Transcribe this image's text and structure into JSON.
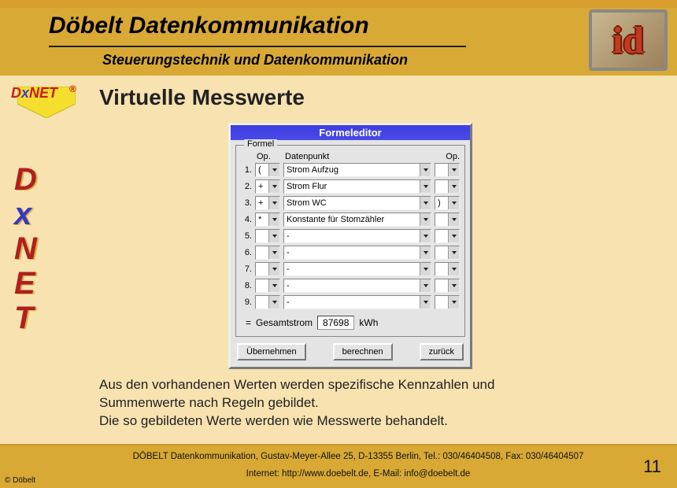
{
  "header": {
    "title": "Döbelt Datenkommunikation",
    "subtitle": "Steuerungstechnik und Datenkommunikation",
    "logo_text": "id"
  },
  "brand": {
    "d": "D",
    "x": "x",
    "net": "NET",
    "reg": "®"
  },
  "vertical": [
    "D",
    "x",
    "N",
    "E",
    "T"
  ],
  "slide_title": "Virtuelle Messwerte",
  "editor": {
    "title": "Formeleditor",
    "legend": "Formel",
    "col_op": "Op.",
    "col_dp": "Datenpunkt",
    "col_op2": "Op.",
    "rows": [
      {
        "n": "1.",
        "op1": "(",
        "dp": "Strom Aufzug",
        "op2": ""
      },
      {
        "n": "2.",
        "op1": "+",
        "dp": "Strom Flur",
        "op2": ""
      },
      {
        "n": "3.",
        "op1": "+",
        "dp": "Strom WC",
        "op2": ")"
      },
      {
        "n": "4.",
        "op1": "*",
        "dp": "Konstante für Stomzähler",
        "op2": ""
      },
      {
        "n": "5.",
        "op1": "",
        "dp": "-",
        "op2": ""
      },
      {
        "n": "6.",
        "op1": "",
        "dp": "-",
        "op2": ""
      },
      {
        "n": "7.",
        "op1": "",
        "dp": "-",
        "op2": ""
      },
      {
        "n": "8.",
        "op1": "",
        "dp": "-",
        "op2": ""
      },
      {
        "n": "9.",
        "op1": "",
        "dp": "-",
        "op2": ""
      }
    ],
    "result_prefix": "=",
    "result_label": "Gesamtstrom",
    "result_value": "87698",
    "result_unit": "kWh",
    "btn_apply": "Übernehmen",
    "btn_calc": "berechnen",
    "btn_back": "zurück"
  },
  "caption_line1": "Aus den vorhandenen Werten werden spezifische Kennzahlen und",
  "caption_line2": "Summenwerte nach Regeln gebildet.",
  "caption_line3": "Die so gebildeten Werte werden wie Messwerte behandelt.",
  "footer": {
    "copyright": "© Döbelt",
    "address": "DÖBELT Datenkommunikation, Gustav-Meyer-Allee 25, D-13355 Berlin, Tel.: 030/46404508, Fax: 030/46404507",
    "web": "Internet: http://www.doebelt.de, E-Mail: info@doebelt.de",
    "page": "11"
  }
}
